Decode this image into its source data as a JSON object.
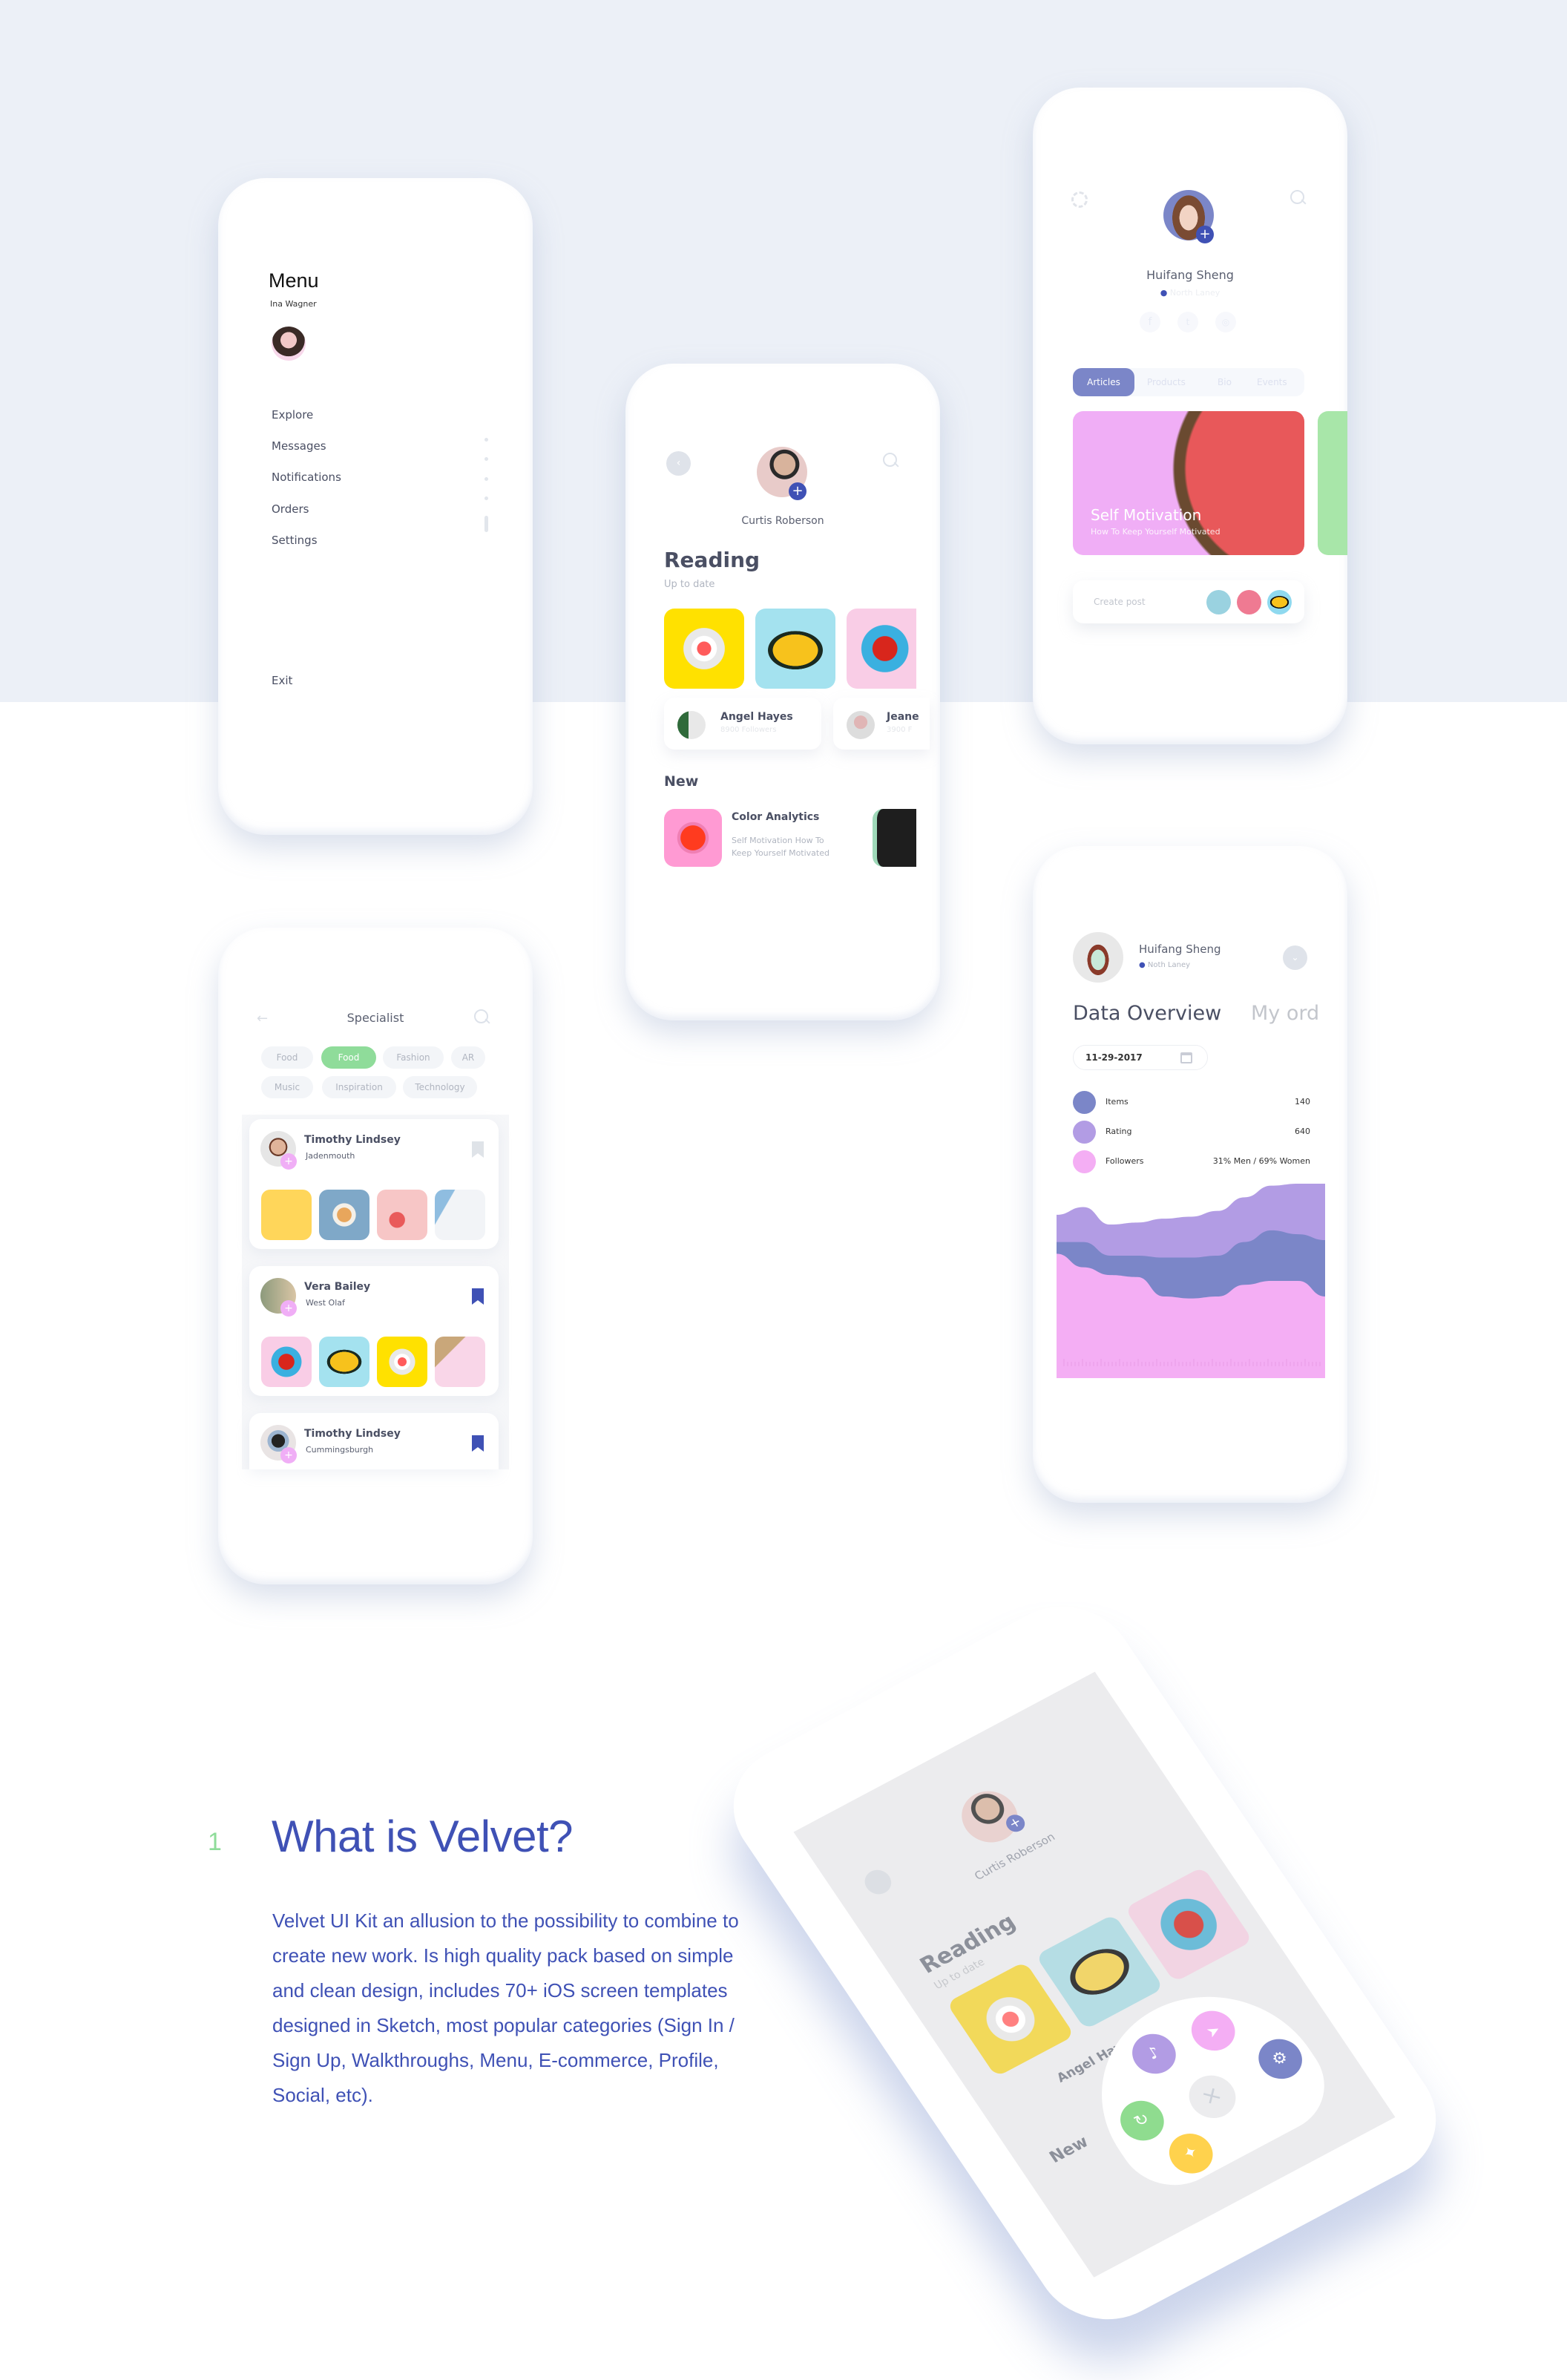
{
  "colors": {
    "brand": "#3f51b5",
    "accent_green": "#8fdc9a",
    "purple": "#b29ce4",
    "indigo": "#7b86c8",
    "pink": "#f4aef4",
    "bg_top": "#ecf0f7"
  },
  "menu_screen": {
    "title": "Menu",
    "user_name": "Ina Wagner",
    "items": [
      "Explore",
      "Messages",
      "Notifications",
      "Orders",
      "Settings"
    ],
    "exit_label": "Exit"
  },
  "reading_screen": {
    "user_name": "Curtis Roberson",
    "section_title": "Reading",
    "section_subtitle": "Up to date",
    "people": [
      {
        "name": "Angel Hayes",
        "followers": "8900 Followers"
      },
      {
        "name": "Jeane",
        "followers": "3900 F"
      }
    ],
    "new_title": "New",
    "new_item": {
      "title": "Color Analytics",
      "desc_line1": "Self Motivation How To",
      "desc_line2": "Keep Yourself Motivated"
    }
  },
  "profile_screen": {
    "user_name": "Huifang Sheng",
    "location": "North Laney",
    "social": [
      "facebook",
      "twitter",
      "instagram"
    ],
    "tabs": [
      "Articles",
      "Products",
      "Bio",
      "Events"
    ],
    "active_tab": "Articles",
    "feature_card": {
      "title": "Self Motivation",
      "subtitle": "How To Keep Yourself Motivated"
    },
    "create_post_placeholder": "Create post"
  },
  "specialist_screen": {
    "title": "Specialist",
    "chips_row1": [
      "Food",
      "Food",
      "Fashion",
      "AR"
    ],
    "chips_row2": [
      "Music",
      "Inspiration",
      "Technology"
    ],
    "active_chip_index": 1,
    "cards": [
      {
        "name": "Timothy Lindsey",
        "location": "Jadenmouth",
        "bookmarked": false
      },
      {
        "name": "Vera Bailey",
        "location": "West Olaf",
        "bookmarked": true
      },
      {
        "name": "Timothy Lindsey",
        "location": "Cummingsburgh",
        "bookmarked": true
      }
    ]
  },
  "data_screen": {
    "user_name": "Huifang Sheng",
    "location": "Noth Laney",
    "title": "Data Overview",
    "title_next": "My ord",
    "date": "11-29-2017",
    "legend": [
      {
        "label": "Items",
        "value": "140",
        "color": "#7b86c8"
      },
      {
        "label": "Rating",
        "value": "640",
        "color": "#b29ce4"
      },
      {
        "label": "Followers",
        "value": "31% Men /  69% Women",
        "color": "#f4aef4"
      }
    ]
  },
  "chart_data": {
    "type": "area",
    "title": "",
    "xlabel": "",
    "ylabel": "",
    "x": [
      0,
      1,
      2,
      3,
      4,
      5,
      6,
      7,
      8,
      9,
      10
    ],
    "series": [
      {
        "name": "Rating",
        "color": "#b29ce4",
        "values": [
          84,
          88,
          79,
          80,
          82,
          83,
          86,
          93,
          99,
          100,
          100
        ]
      },
      {
        "name": "Items",
        "color": "#7b86c8",
        "values": [
          70,
          70,
          63,
          63,
          62,
          62,
          63,
          70,
          76,
          74,
          71
        ]
      },
      {
        "name": "Followers",
        "color": "#f4aef4",
        "values": [
          64,
          57,
          53,
          52,
          42,
          41,
          42,
          48,
          50,
          50,
          42
        ]
      }
    ],
    "ylim": [
      0,
      100
    ],
    "grid": false,
    "legend": "top"
  },
  "intro": {
    "number": "1",
    "heading": "What is Velvet?",
    "paragraph": "Velvet UI Kit an allusion to the possibility to combine to create new work. Is high quality pack based on simple and clean design, includes 70+ iOS screen templates designed in Sketch, most popular categories (Sign In / Sign Up, Walkthroughs, Menu, E-commerce, Profile, Social, etc)."
  },
  "tilted_phone": {
    "user_name": "Curtis Roberson",
    "section_title": "Reading",
    "section_subtitle": "Up to date",
    "person": "Angel Hayes",
    "new_title": "New",
    "fab_actions": [
      "notifications",
      "send",
      "refresh",
      "settings",
      "explore"
    ],
    "close_label": "×"
  }
}
